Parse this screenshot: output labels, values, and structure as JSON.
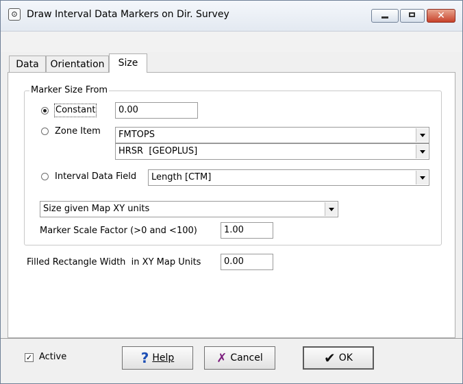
{
  "window": {
    "title": "Draw Interval Data Markers on Dir. Survey"
  },
  "icons": {
    "app": "map-marker-icon",
    "minimize": "minimize-icon",
    "maximize": "maximize-icon",
    "close": "close-icon",
    "help": "help-icon",
    "cancel": "cancel-icon",
    "ok": "checkmark-icon"
  },
  "tabs": [
    {
      "label": "Data",
      "selected": false
    },
    {
      "label": "Orientation",
      "selected": false
    },
    {
      "label": "Size",
      "selected": true
    }
  ],
  "marker_group": {
    "legend": "Marker Size From",
    "constant": {
      "label": "Constant",
      "selected": true,
      "value": "0.00"
    },
    "zone_item": {
      "label": "Zone Item",
      "selected": false,
      "combo1": "FMTOPS",
      "combo2": "HRSR  [GEOPLUS]"
    },
    "interval_field": {
      "label": "Interval Data Field",
      "selected": false,
      "combo": "Length [CTM]"
    },
    "size_units": "Size given Map XY units",
    "scale": {
      "label": "Marker Scale Factor (>0 and <100)",
      "value": "1.00"
    }
  },
  "rect_width": {
    "label": "Filled Rectangle Width  in XY Map Units",
    "value": "0.00"
  },
  "footer": {
    "active": {
      "label": "Active",
      "checked": true
    },
    "help": "Help",
    "cancel": "Cancel",
    "ok": "OK"
  }
}
